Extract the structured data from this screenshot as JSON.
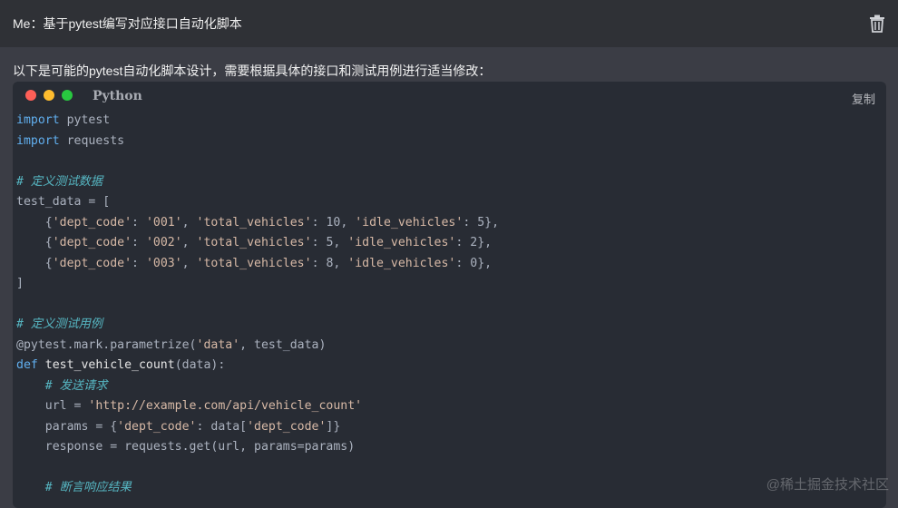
{
  "question": {
    "text": "Me：基于pytest编写对应接口自动化脚本"
  },
  "intro": {
    "text": "以下是可能的pytest自动化脚本设计，需要根据具体的接口和测试用例进行适当修改："
  },
  "code_block": {
    "language": "Python",
    "copy_label": "复制",
    "lines": {
      "l1": {
        "kw": "import",
        "rest": " pytest"
      },
      "l2": {
        "kw": "import",
        "rest": " requests"
      },
      "l3": {
        "comment": "# 定义测试数据"
      },
      "l4": {
        "text": "test_data = ["
      },
      "r1": {
        "a": "    {",
        "k1": "'dept_code'",
        "b": ": ",
        "v1": "'001'",
        "c": ", ",
        "k2": "'total_vehicles'",
        "d": ": 10, ",
        "k3": "'idle_vehicles'",
        "e": ": 5},"
      },
      "r2": {
        "a": "    {",
        "k1": "'dept_code'",
        "b": ": ",
        "v1": "'002'",
        "c": ", ",
        "k2": "'total_vehicles'",
        "d": ": 5, ",
        "k3": "'idle_vehicles'",
        "e": ": 2},"
      },
      "r3": {
        "a": "    {",
        "k1": "'dept_code'",
        "b": ": ",
        "v1": "'003'",
        "c": ", ",
        "k2": "'total_vehicles'",
        "d": ": 8, ",
        "k3": "'idle_vehicles'",
        "e": ": 0},"
      },
      "l8": {
        "text": "]"
      },
      "l9": {
        "comment": "# 定义测试用例"
      },
      "l10": {
        "a": "@pytest.mark.parametrize(",
        "s": "'data'",
        "b": ", test_data)"
      },
      "l11": {
        "kw": "def",
        "fn": " test_vehicle_count",
        "rest": "(data):"
      },
      "l12": {
        "comment": "    # 发送请求"
      },
      "l13": {
        "a": "    url = ",
        "s": "'http://example.com/api/vehicle_count'"
      },
      "l14": {
        "a": "    params = {",
        "s1": "'dept_code'",
        "b": ": data[",
        "s2": "'dept_code'",
        "c": "]}"
      },
      "l15": {
        "text": "    response = requests.get(url, params=params)"
      },
      "l16": {
        "comment": "    # 断言响应结果"
      }
    }
  },
  "watermark": {
    "text": "@稀土掘金技术社区"
  },
  "icons": {
    "trash": "trash-icon"
  }
}
